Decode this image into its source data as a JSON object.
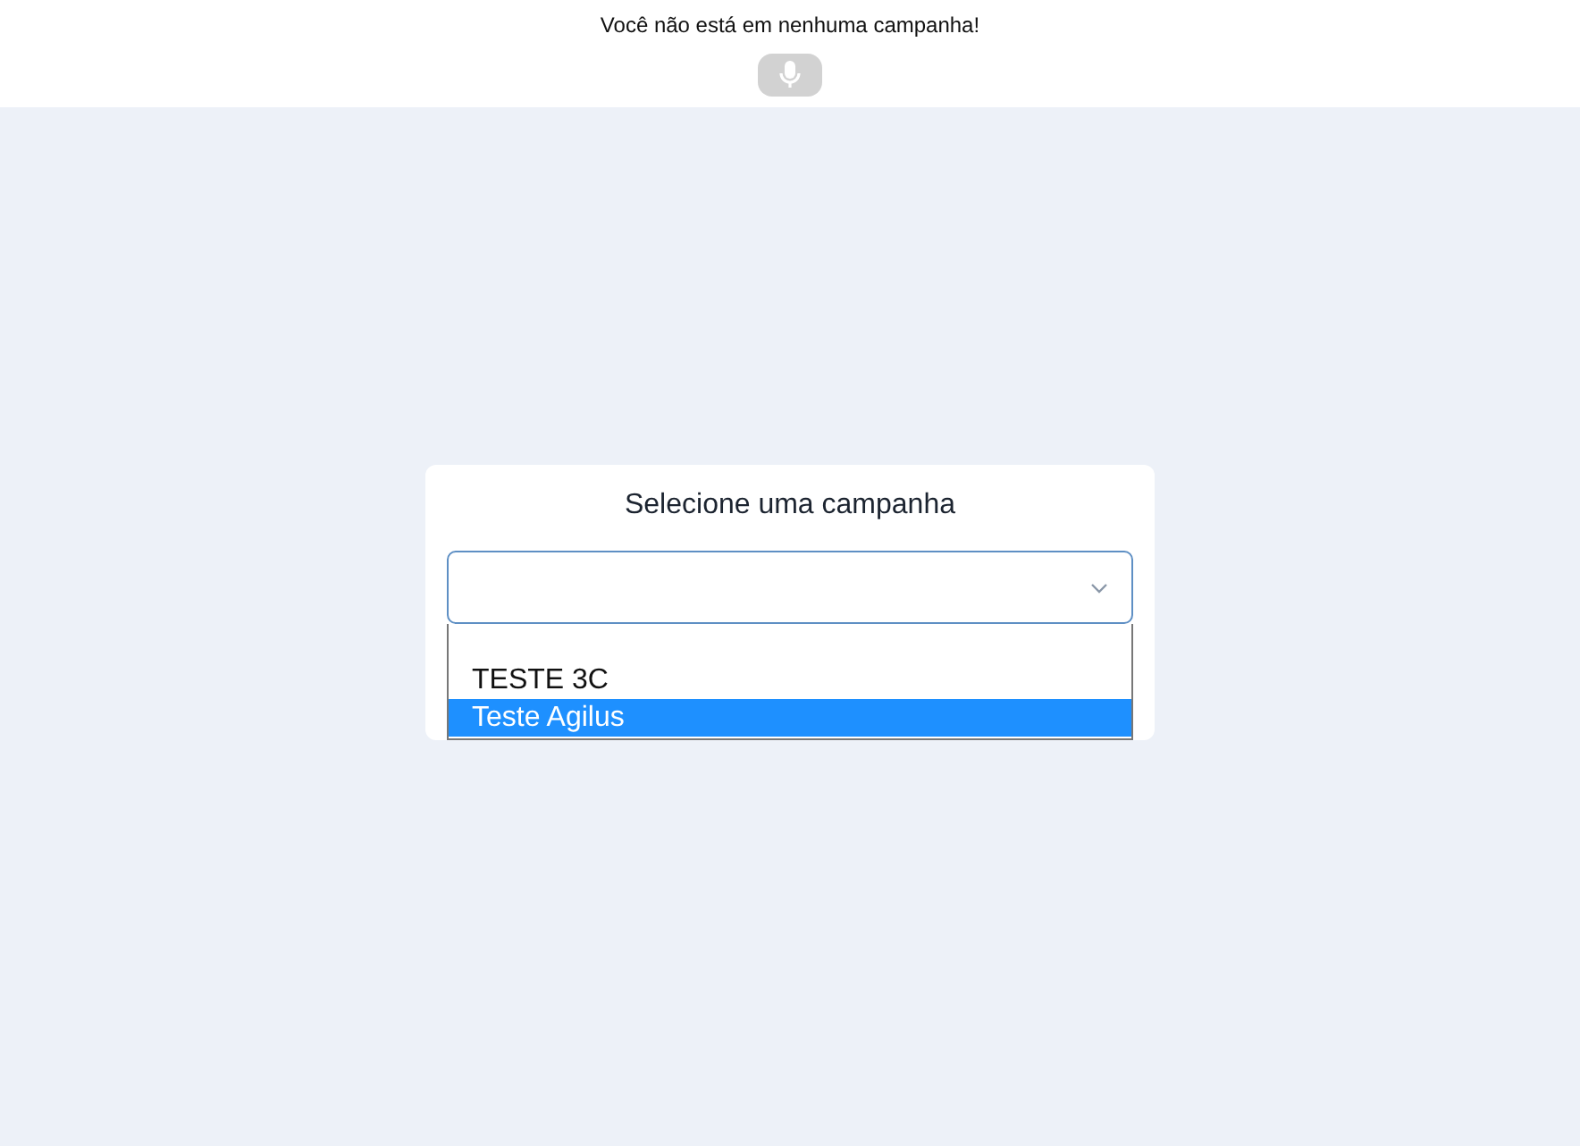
{
  "header": {
    "message": "Você não está em nenhuma campanha!",
    "mic_button": {
      "disabled": true
    }
  },
  "campaign_card": {
    "title": "Selecione uma campanha",
    "select": {
      "expanded": true
    },
    "options": [
      {
        "label": "TESTE 3C",
        "selected": false
      },
      {
        "label": "Teste Agilus",
        "selected": true
      }
    ]
  }
}
